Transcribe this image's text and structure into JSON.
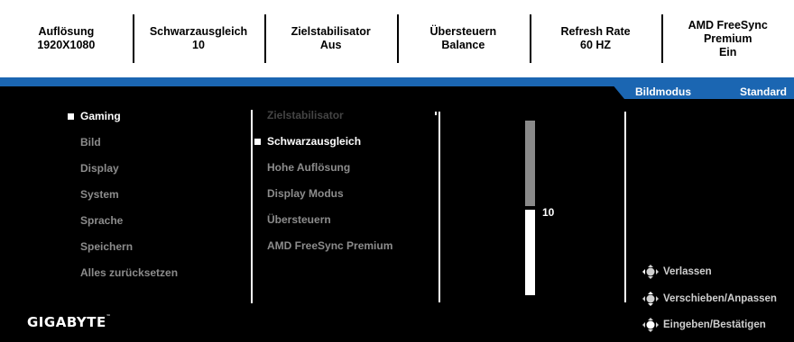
{
  "top_info": [
    {
      "label": "Auflösung",
      "value": "1920X1080"
    },
    {
      "label": "Schwarzausgleich",
      "value": "10"
    },
    {
      "label": "Zielstabilisator",
      "value": "Aus"
    },
    {
      "label": "Übersteuern",
      "value": "Balance"
    },
    {
      "label": "Refresh Rate",
      "value": "60 HZ"
    },
    {
      "label": "AMD FreeSync",
      "label2": "Premium",
      "value": "Ein"
    }
  ],
  "mode_bar": {
    "label": "Bildmodus",
    "value": "Standard",
    "color": "#1b66b2"
  },
  "main_menu": {
    "items": [
      "Gaming",
      "Bild",
      "Display",
      "System",
      "Sprache",
      "Speichern",
      "Alles zurücksetzen"
    ],
    "selected": "Gaming"
  },
  "sub_menu": {
    "items": [
      "Zielstabilisator",
      "Schwarzausgleich",
      "Hohe Auflösung",
      "Display Modus",
      "Übersteuern",
      "AMD FreeSync Premium"
    ],
    "selected": "Schwarzausgleich",
    "disabled": [
      "Zielstabilisator"
    ]
  },
  "slider": {
    "value": "10",
    "min": 0,
    "max": 20,
    "level": 0.5
  },
  "hints": [
    {
      "icon": "joystick-icon",
      "label": "Verlassen"
    },
    {
      "icon": "joystick-icon",
      "label": "Verschieben/Anpassen"
    },
    {
      "icon": "joystick-icon",
      "label": "Eingeben/Bestätigen"
    }
  ],
  "brand": {
    "name": "GIGABYTE"
  }
}
